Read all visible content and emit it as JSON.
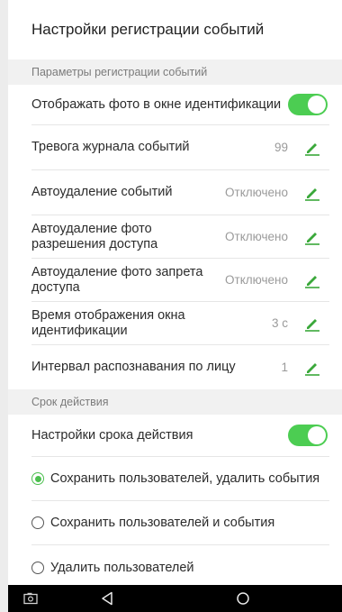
{
  "title": "Настройки регистрации событий",
  "section_registration": "Параметры регистрации событий",
  "rows": [
    {
      "label": "Отображать фото в окне идентификации",
      "value": ""
    },
    {
      "label": "Тревога журнала событий",
      "value": "99"
    },
    {
      "label": "Автоудаление событий",
      "value": "Отключено"
    },
    {
      "label": "Автоудаление фото разрешения доступа",
      "value": "Отключено"
    },
    {
      "label": "Автоудаление фото запрета доступа",
      "value": "Отключено"
    },
    {
      "label": "Время отображения окна идентификации",
      "value": "3 с"
    },
    {
      "label": "Интервал распознавания по лицу",
      "value": "1"
    }
  ],
  "section_validity": "Срок действия",
  "validity_toggle_label": "Настройки срока действия",
  "radio_options": [
    {
      "label": "Сохранить пользователей, удалить события",
      "selected": true
    },
    {
      "label": "Сохранить пользователей и события",
      "selected": false
    },
    {
      "label": "Удалить пользователей",
      "selected": false
    }
  ],
  "toggles": {
    "show_photo": true,
    "validity_settings": true
  },
  "colors": {
    "accent": "#4ccd52",
    "edit_icon": "#3aa83a",
    "navbar": "#000000"
  },
  "icons": {
    "edit": "pencil-icon",
    "nav": [
      "screenshot-icon",
      "back-icon",
      "home-icon"
    ]
  }
}
